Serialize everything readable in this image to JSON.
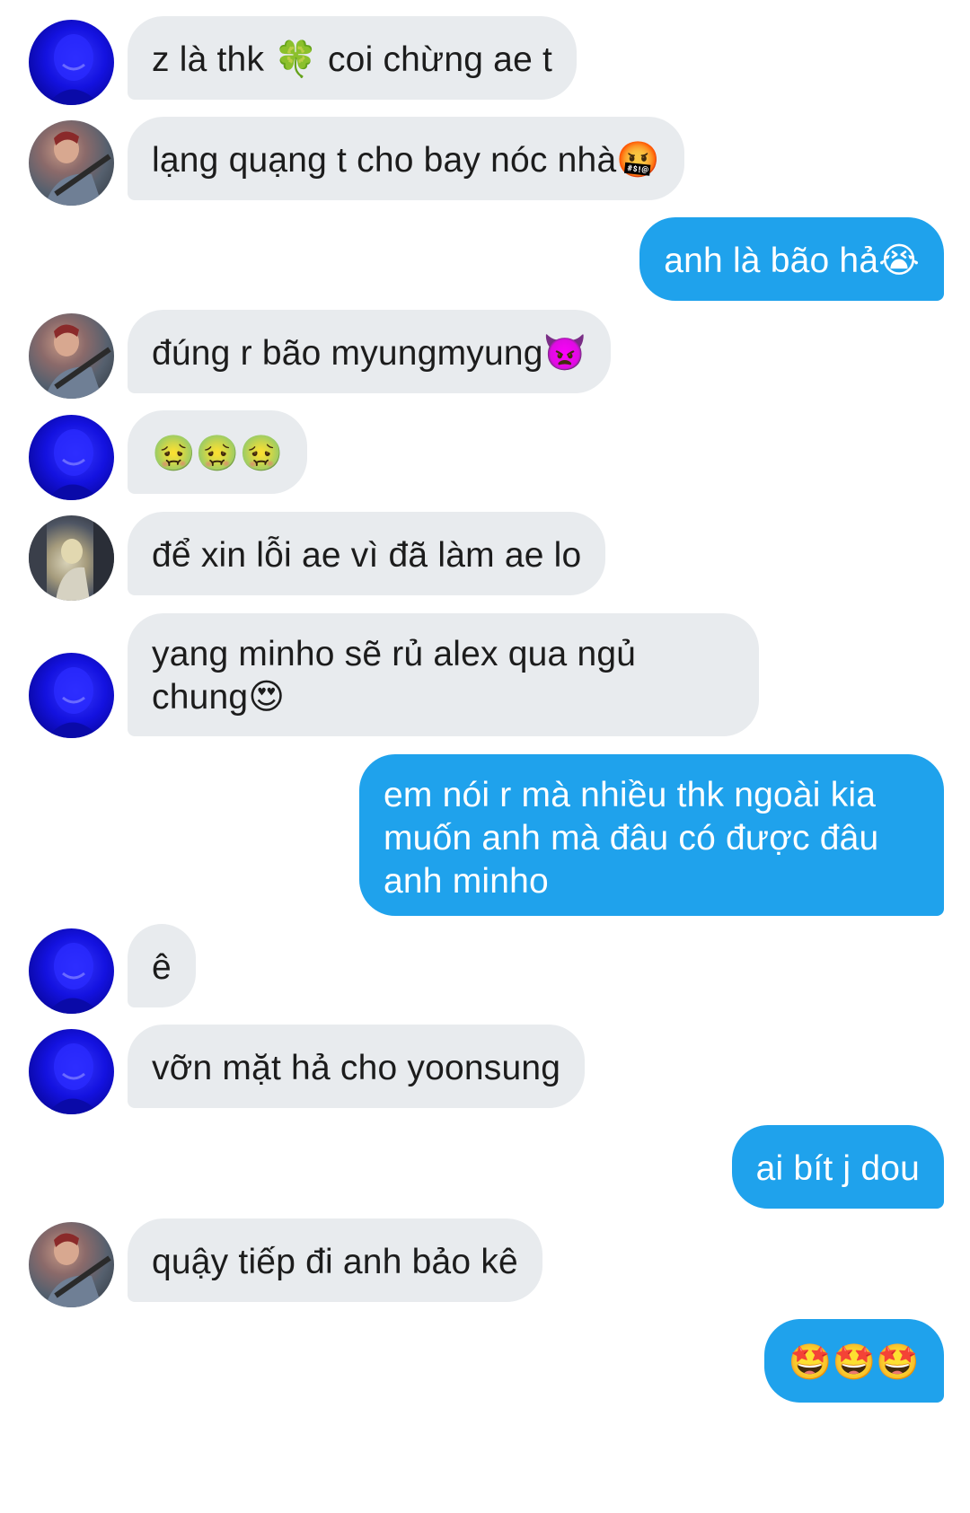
{
  "messages": [
    {
      "side": "in",
      "avatar": "blue-portrait-avatar",
      "text": "z là thk 🍀 coi chừng ae t"
    },
    {
      "side": "in",
      "avatar": "guitar-portrait-avatar",
      "text": "lạng quạng t cho bay nóc nhà🤬"
    },
    {
      "side": "out",
      "text": "anh là bão hả😭"
    },
    {
      "side": "in",
      "avatar": "guitar-portrait-avatar",
      "text": "đúng r bão myungmyung👿"
    },
    {
      "side": "in",
      "avatar": "blue-portrait-avatar",
      "text": "🤢🤢🤢"
    },
    {
      "side": "in",
      "avatar": "street-portrait-avatar",
      "text": "để xin lỗi ae vì đã làm ae lo"
    },
    {
      "side": "in",
      "avatar": "blue-portrait-avatar",
      "text": "yang minho sẽ rủ alex qua ngủ chung😍"
    },
    {
      "side": "out",
      "text": "em nói r mà nhiều thk ngoài kia muốn anh mà đâu có được đâu anh minho"
    },
    {
      "side": "in",
      "avatar": "blue-portrait-avatar",
      "text": "ê"
    },
    {
      "side": "in",
      "avatar": "blue-portrait-avatar",
      "text": "vỡn mặt hả cho yoonsung"
    },
    {
      "side": "out",
      "text": "ai bít j dou"
    },
    {
      "side": "in",
      "avatar": "guitar-portrait-avatar",
      "text": "quậy tiếp đi anh bảo kê"
    },
    {
      "side": "out",
      "text": "🤩🤩🤩"
    }
  ],
  "colors": {
    "incoming_bubble": "#e8ebee",
    "outgoing_bubble": "#1fa2ec",
    "incoming_text": "#1c1c1c",
    "outgoing_text": "#ffffff"
  }
}
